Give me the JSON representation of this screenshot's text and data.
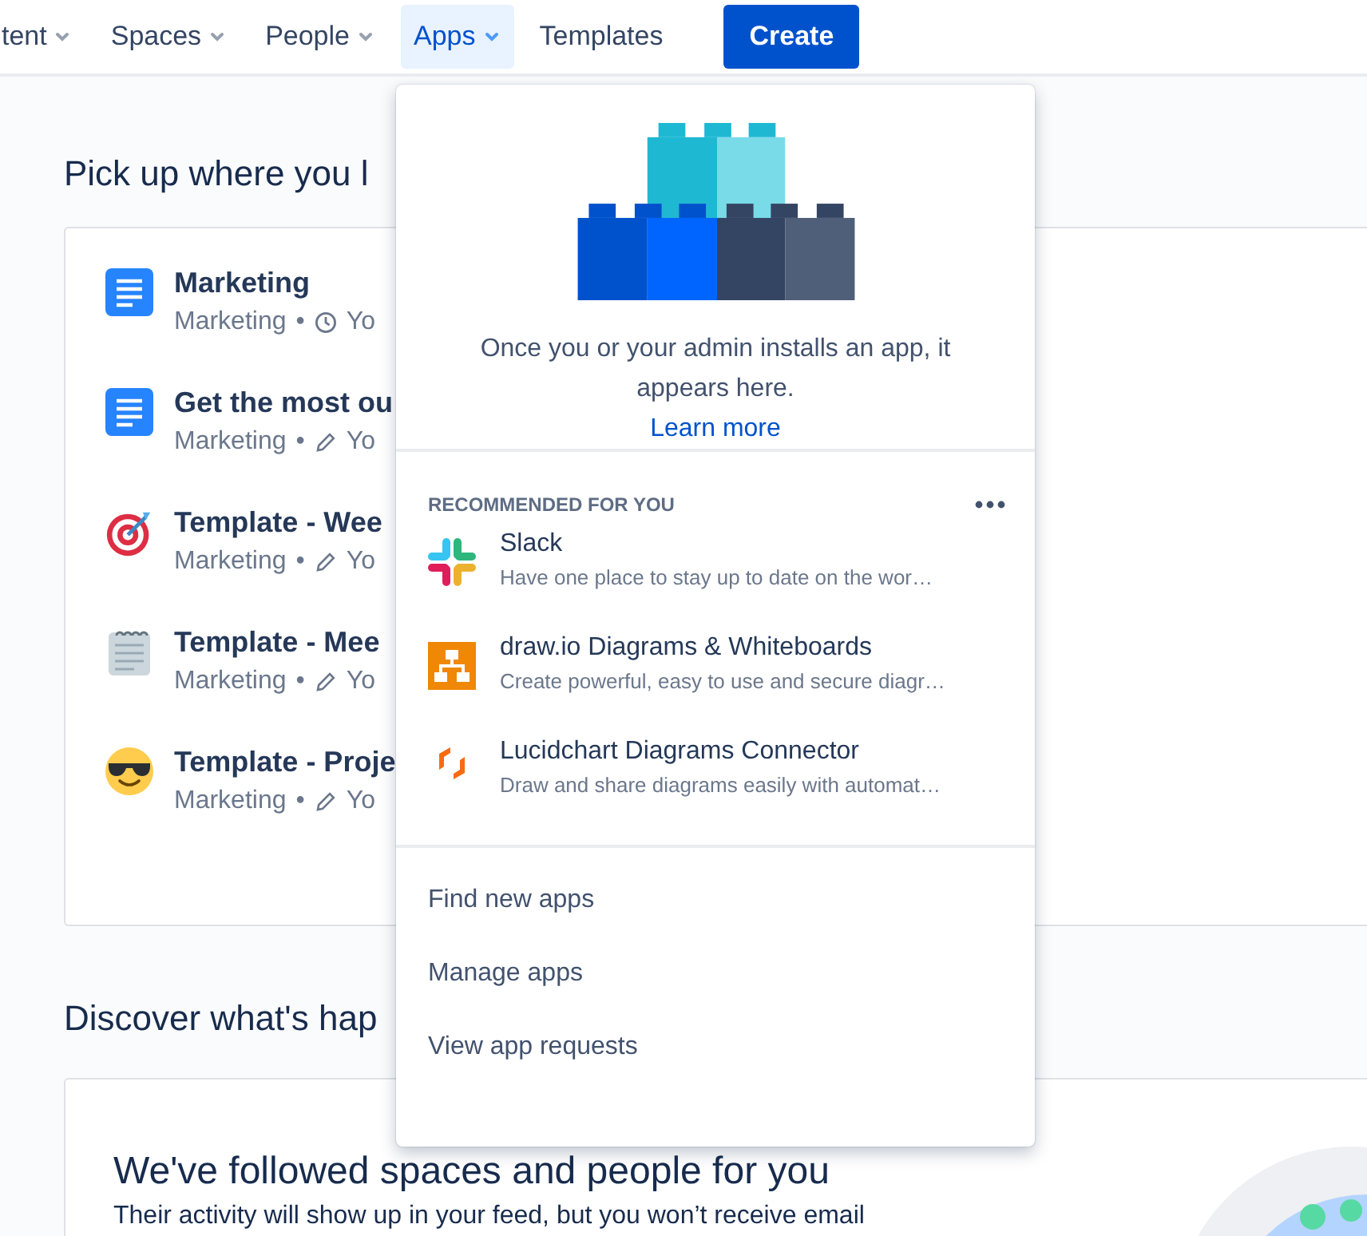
{
  "nav": {
    "items": [
      {
        "label": "tent",
        "dropdown": true,
        "selected": false
      },
      {
        "label": "Spaces",
        "dropdown": true,
        "selected": false
      },
      {
        "label": "People",
        "dropdown": true,
        "selected": false
      },
      {
        "label": "Apps",
        "dropdown": true,
        "selected": true
      },
      {
        "label": "Templates",
        "dropdown": false,
        "selected": false
      }
    ],
    "create_button": "Create"
  },
  "recent": {
    "heading": "Pick up where you l",
    "items": [
      {
        "kind": "page",
        "title": "Marketing",
        "space": "Marketing",
        "separator": "•",
        "viewed": true,
        "meta": "Yo"
      },
      {
        "kind": "page",
        "title": "Get the most ou",
        "space": "Marketing",
        "separator": "•",
        "viewed": false,
        "meta": "Yo"
      },
      {
        "kind": "target",
        "title": "Template - Wee",
        "space": "Marketing",
        "separator": "•",
        "viewed": false,
        "meta": "Yo"
      },
      {
        "kind": "notepad",
        "title": "Template - Mee",
        "space": "Marketing",
        "separator": "•",
        "viewed": false,
        "meta": "Yo"
      },
      {
        "kind": "sunglasses",
        "title": "Template - Proje",
        "space": "Marketing",
        "separator": "•",
        "viewed": false,
        "meta": "Yo"
      }
    ]
  },
  "discover": {
    "heading": "Discover what's hap",
    "card_title": "We've followed spaces and people for you",
    "card_text": "Their activity will show up in your feed, but you won’t receive email"
  },
  "apps_menu": {
    "empty_message": "Once you or your admin installs an app, it appears here.",
    "learn_more": "Learn more",
    "section_title": "RECOMMENDED FOR YOU",
    "apps": [
      {
        "kind": "slack",
        "name": "Slack",
        "description": "Have one place to stay up to date on the wor…"
      },
      {
        "kind": "drawio",
        "name": "draw.io Diagrams & Whiteboards",
        "description": "Create powerful, easy to use and secure diagr…"
      },
      {
        "kind": "lucidchart",
        "name": "Lucidchart Diagrams Connector",
        "description": "Draw and share diagrams easily with automat…"
      }
    ],
    "links": [
      "Find new apps",
      "Manage apps",
      "View app requests"
    ]
  }
}
